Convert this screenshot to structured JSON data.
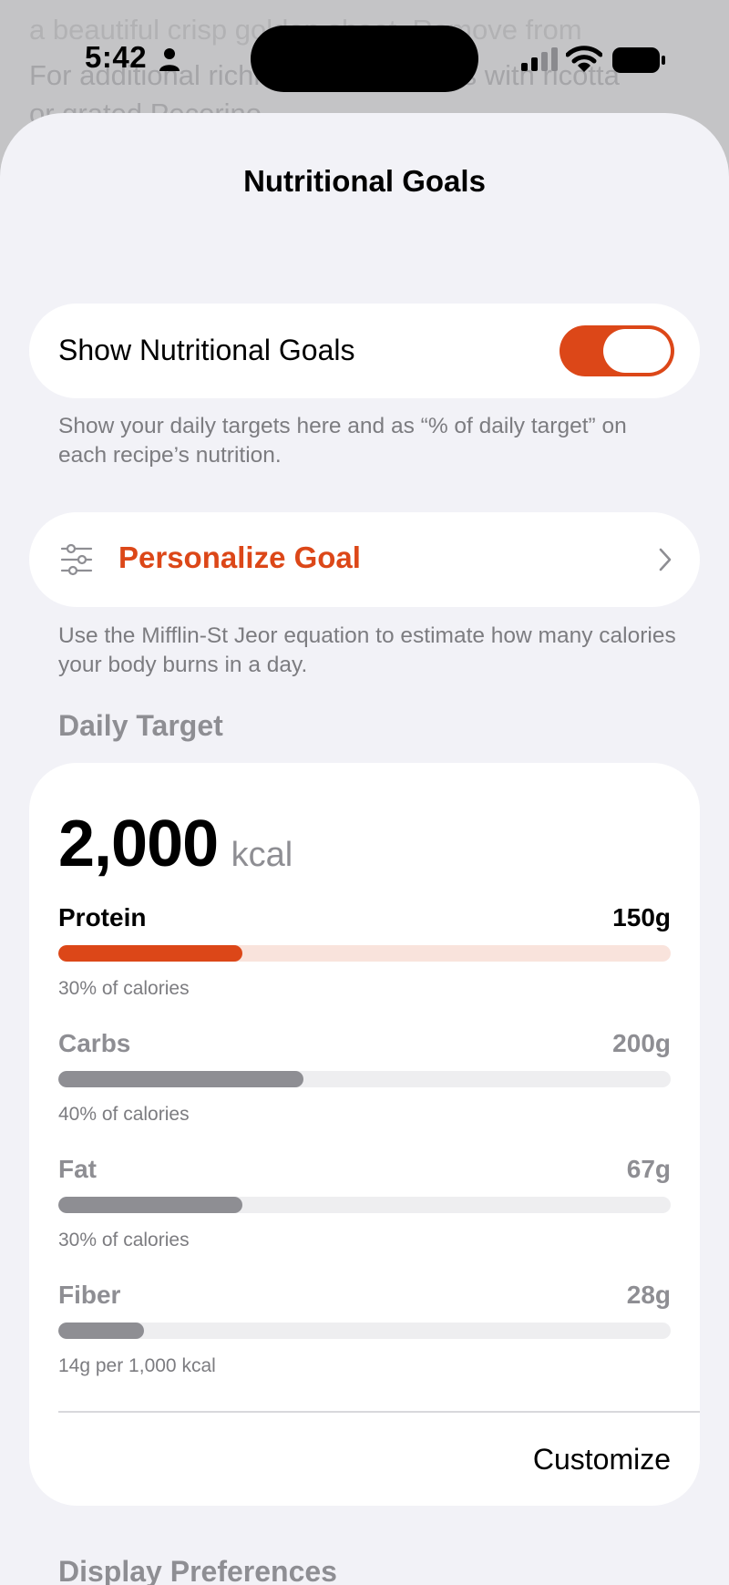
{
  "background": {
    "lines": [
      "a beautiful crisp golden sheet. Remove from",
      "For additional richness, top portions with ricotta",
      "or grated Pecorino."
    ]
  },
  "status_bar": {
    "time": "5:42",
    "icons": [
      "person-icon",
      "cellular-signal-icon",
      "wifi-icon",
      "battery-icon"
    ]
  },
  "sheet": {
    "title": "Nutritional Goals"
  },
  "show_goals": {
    "label": "Show Nutritional Goals",
    "enabled": true,
    "footnote": "Show your daily targets here and as “% of daily target” on each recipe’s nutrition."
  },
  "personalize": {
    "icon": "sliders-icon",
    "label": "Personalize Goal",
    "footnote": "Use the Mifflin-St Jeor equation to estimate how many calories your body burns in a day."
  },
  "daily_target": {
    "header": "Daily Target",
    "calories": "2,000",
    "unit": "kcal",
    "macros": [
      {
        "name": "Protein",
        "amount": "150g",
        "sub": "30% of calories",
        "fraction": 0.3,
        "active": true
      },
      {
        "name": "Carbs",
        "amount": "200g",
        "sub": "40% of calories",
        "fraction": 0.4,
        "active": false
      },
      {
        "name": "Fat",
        "amount": "67g",
        "sub": "30% of calories",
        "fraction": 0.3,
        "active": false
      },
      {
        "name": "Fiber",
        "amount": "28g",
        "sub": "14g per 1,000 kcal",
        "fraction": 0.14,
        "active": false
      }
    ],
    "customize_label": "Customize"
  },
  "next_section": {
    "header": "Display Preferences"
  },
  "colors": {
    "accent": "#dc4718",
    "accent_track": "#f9e3dc",
    "neutral_bar": "#8e8e93",
    "neutral_track": "#eeeef0"
  }
}
